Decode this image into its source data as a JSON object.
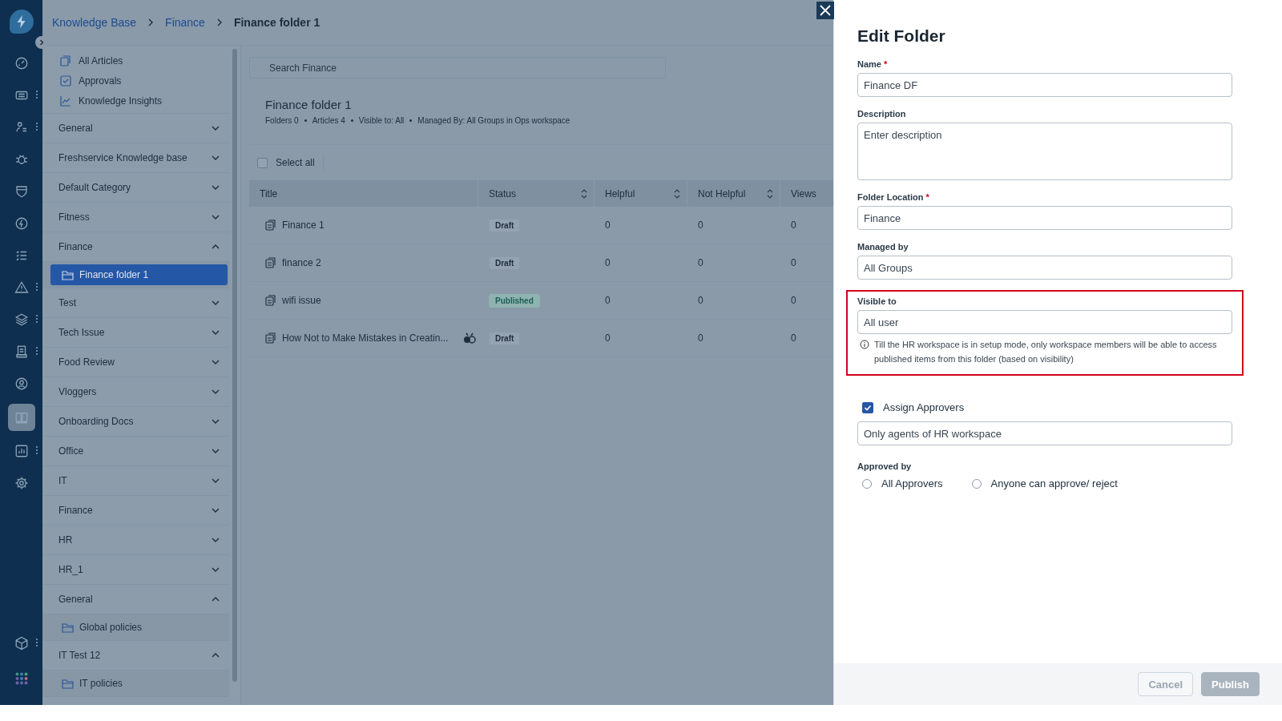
{
  "rail": [
    {
      "selected": false,
      "menu": false
    },
    {
      "selected": false,
      "menu": true
    },
    {
      "selected": false,
      "menu": true
    },
    {
      "selected": false,
      "menu": false
    },
    {
      "selected": false,
      "menu": false
    },
    {
      "selected": false,
      "menu": false
    },
    {
      "selected": false,
      "menu": false
    },
    {
      "selected": false,
      "menu": true
    },
    {
      "selected": false,
      "menu": true
    },
    {
      "selected": false,
      "menu": true
    },
    {
      "selected": false,
      "menu": false
    },
    {
      "selected": true,
      "menu": false
    },
    {
      "selected": false,
      "menu": true
    },
    {
      "selected": false,
      "menu": false
    }
  ],
  "rail_bottom": [
    {
      "selected": false,
      "menu": true
    },
    {
      "selected": false,
      "menu": false
    }
  ],
  "breadcrumb": [
    {
      "label": "Knowledge Base",
      "current": false
    },
    {
      "label": "Finance",
      "current": false
    },
    {
      "label": "Finance folder 1",
      "current": true
    }
  ],
  "sidebar": {
    "links": [
      "All Articles",
      "Approvals",
      "Knowledge Insights"
    ],
    "categories": [
      {
        "label": "General",
        "expanded": false
      },
      {
        "label": "Freshservice Knowledge base",
        "expanded": false
      },
      {
        "label": "Default Category",
        "expanded": false
      },
      {
        "label": "Fitness",
        "expanded": false
      },
      {
        "label": "Finance",
        "expanded": true,
        "children": [
          {
            "label": "Finance folder 1",
            "selected": true
          }
        ]
      },
      {
        "label": "Test",
        "expanded": false
      },
      {
        "label": "Tech Issue",
        "expanded": false
      },
      {
        "label": "Food Review",
        "expanded": false
      },
      {
        "label": "Vloggers",
        "expanded": false
      },
      {
        "label": "Onboarding Docs",
        "expanded": false
      },
      {
        "label": "Office",
        "expanded": false
      },
      {
        "label": "IT",
        "expanded": false
      },
      {
        "label": "Finance",
        "expanded": false
      },
      {
        "label": "HR",
        "expanded": false
      },
      {
        "label": "HR_1",
        "expanded": false
      },
      {
        "label": "General",
        "expanded": true,
        "children": [
          {
            "label": "Global policies",
            "selected": false
          }
        ]
      },
      {
        "label": "IT Test 12",
        "expanded": true,
        "children": [
          {
            "label": "IT policies",
            "selected": false
          }
        ]
      }
    ]
  },
  "search": {
    "placeholder": "Search Finance"
  },
  "folder": {
    "title": "Finance folder 1",
    "meta": [
      "Folders 0",
      "Articles 4",
      "Visible to: All",
      "Managed By: All Groups in Ops workspace"
    ]
  },
  "select_all": {
    "label": "Select all",
    "checked": false
  },
  "table": {
    "columns": [
      {
        "label": "Title",
        "sortable": false
      },
      {
        "label": "Status",
        "sortable": true
      },
      {
        "label": "Helpful",
        "sortable": true
      },
      {
        "label": "Not Helpful",
        "sortable": true
      },
      {
        "label": "Views",
        "sortable": false
      }
    ],
    "rows": [
      {
        "title": "Finance 1",
        "flag": false,
        "status": "Draft",
        "published": false,
        "helpful": "0",
        "not_helpful": "0",
        "views": "0"
      },
      {
        "title": "finance 2",
        "flag": false,
        "status": "Draft",
        "published": false,
        "helpful": "0",
        "not_helpful": "0",
        "views": "0"
      },
      {
        "title": "wifi issue",
        "flag": false,
        "status": "Published",
        "published": true,
        "helpful": "0",
        "not_helpful": "0",
        "views": "0"
      },
      {
        "title": "How Not to Make Mistakes in Creatin...",
        "flag": true,
        "status": "Draft",
        "published": false,
        "helpful": "0",
        "not_helpful": "0",
        "views": "0"
      }
    ]
  },
  "panel": {
    "title": "Edit Folder",
    "fields": [
      {
        "label": "Name",
        "required_mark": "*",
        "kind": "input",
        "value": "Finance DF",
        "highlighted": false
      },
      {
        "label": "Description",
        "kind": "textarea",
        "placeholder": "Enter description",
        "highlighted": false
      },
      {
        "label": "Folder Location",
        "required_mark": "*",
        "kind": "input",
        "value": "Finance",
        "highlighted": false
      },
      {
        "label": "Managed by",
        "kind": "input",
        "value": "All Groups",
        "highlighted": false
      },
      {
        "label": "Visible to",
        "kind": "input",
        "value": "All user",
        "highlighted": true,
        "note": "Till the HR workspace is in setup mode, only workspace members will be able to access published items from this folder (based on visibility)"
      }
    ],
    "assign": {
      "label": "Assign Approvers",
      "checked": true,
      "value": "Only agents of HR workspace"
    },
    "approved_by": {
      "label": "Approved by",
      "options": [
        {
          "label": "All Approvers",
          "selected": false
        },
        {
          "label": "Anyone can approve/ reject",
          "selected": false
        }
      ]
    },
    "buttons": [
      {
        "label": "Cancel",
        "kind": "secondary",
        "disabled": false
      },
      {
        "label": "Publish",
        "kind": "primary",
        "disabled": true
      }
    ]
  }
}
